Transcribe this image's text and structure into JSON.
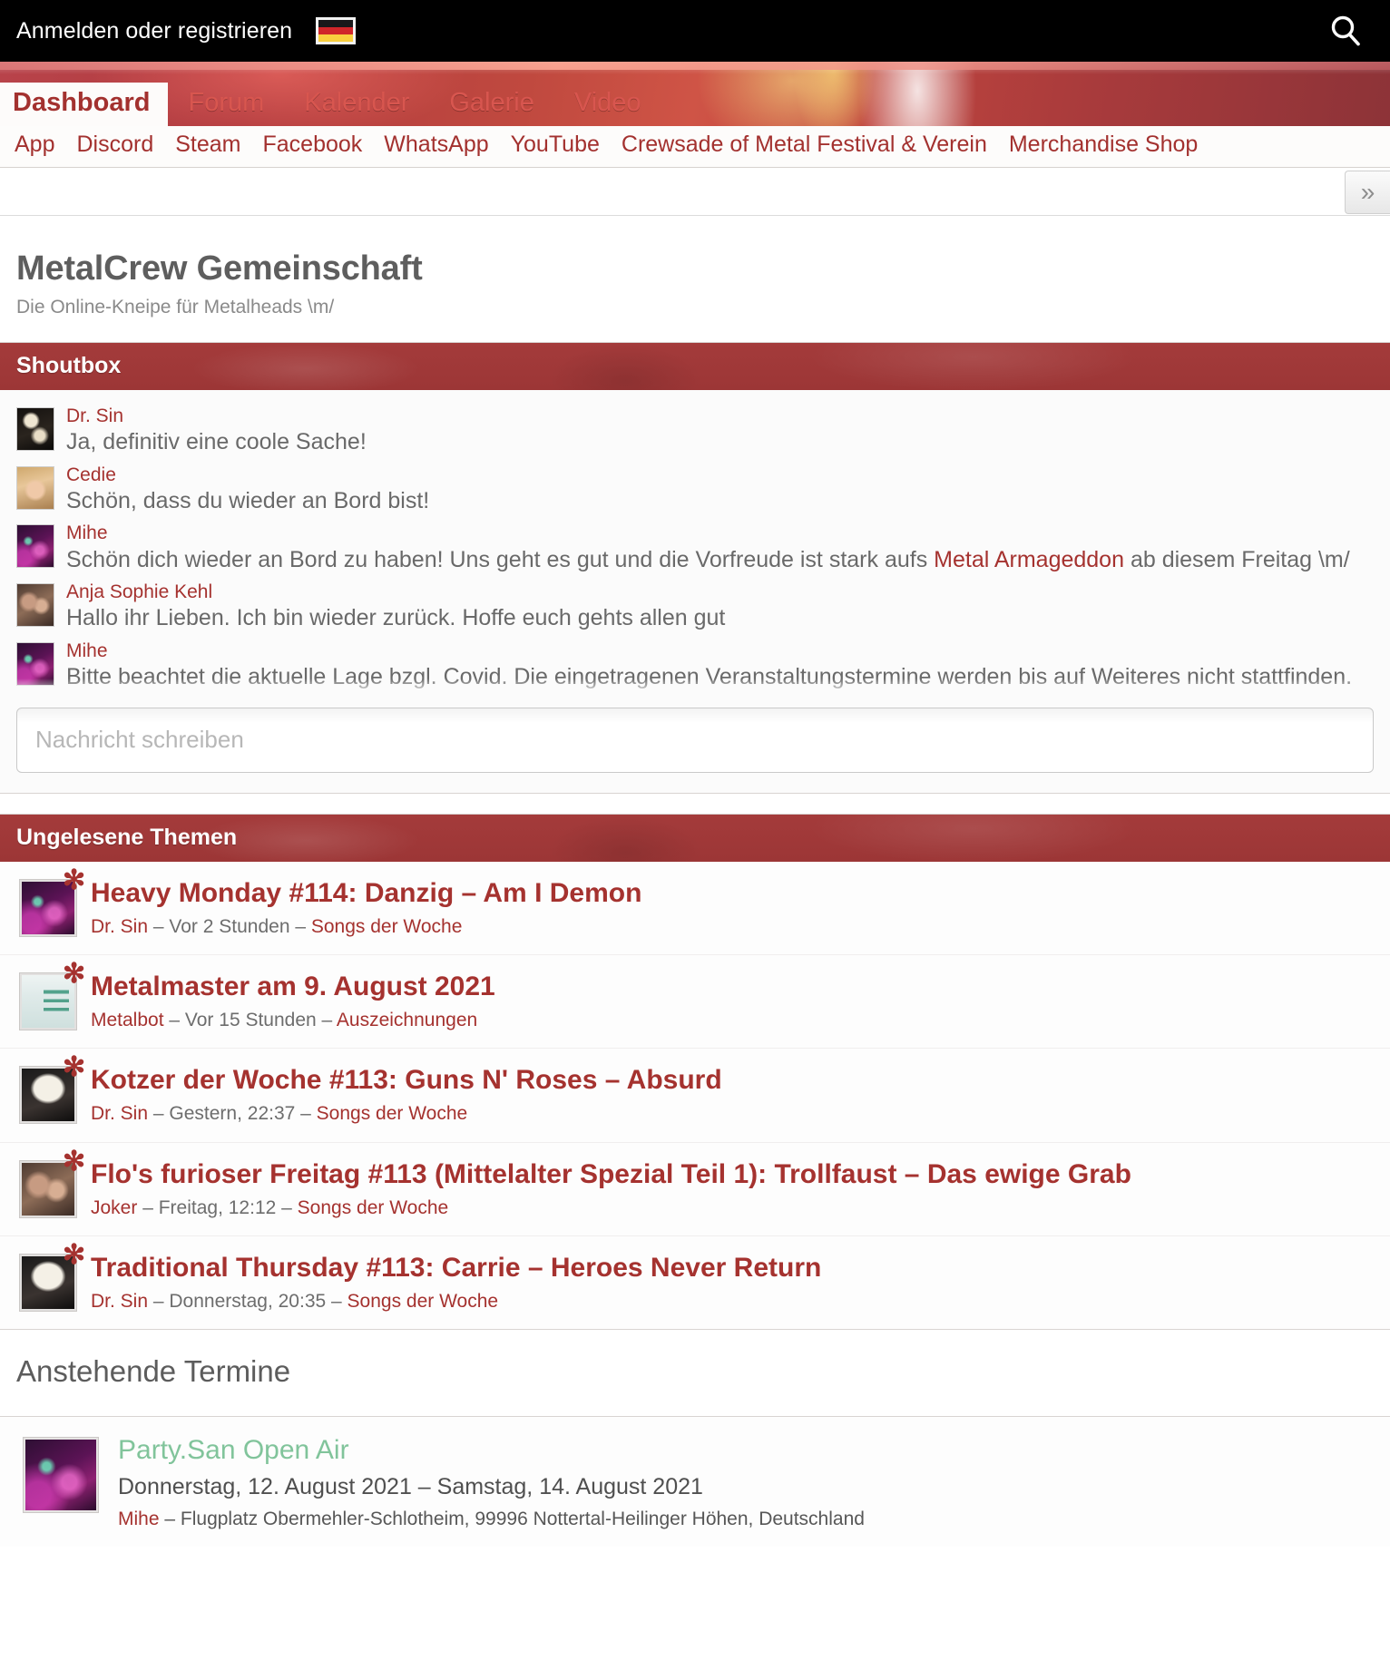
{
  "topbar": {
    "login_label": "Anmelden oder registrieren",
    "language": "Deutsch",
    "search_icon": "search-icon"
  },
  "tabs": [
    {
      "label": "Dashboard",
      "active": true
    },
    {
      "label": "Forum",
      "active": false
    },
    {
      "label": "Kalender",
      "active": false
    },
    {
      "label": "Galerie",
      "active": false
    },
    {
      "label": "Video",
      "active": false
    }
  ],
  "subnav": [
    {
      "label": "App"
    },
    {
      "label": "Discord"
    },
    {
      "label": "Steam"
    },
    {
      "label": "Facebook"
    },
    {
      "label": "WhatsApp"
    },
    {
      "label": "YouTube"
    },
    {
      "label": "Crewsade of Metal Festival & Verein"
    },
    {
      "label": "Merchandise Shop"
    }
  ],
  "expand_button_label": "»",
  "page": {
    "title": "MetalCrew Gemeinschaft",
    "subtitle": "Die Online-Kneipe für Metalheads \\m/"
  },
  "shoutbox": {
    "header": "Shoutbox",
    "input_placeholder": "Nachricht schreiben",
    "input_value": "",
    "messages": [
      {
        "user": "Dr. Sin",
        "avatar": "cat",
        "text": "Ja, definitiv eine coole Sache!",
        "link_text": "",
        "text_after": ""
      },
      {
        "user": "Cedie",
        "avatar": "blonde",
        "text": "Schön, dass du wieder an Bord bist!",
        "link_text": "",
        "text_after": ""
      },
      {
        "user": "Mihe",
        "avatar": "crowd",
        "text": "Schön dich wieder an Bord zu haben! Uns geht es gut und die Vorfreude ist stark aufs ",
        "link_text": "Metal Armageddon",
        "text_after": " ab diesem Freitag \\m/"
      },
      {
        "user": "Anja Sophie Kehl",
        "avatar": "couple",
        "text": "Hallo ihr Lieben. Ich bin wieder zurück. Hoffe euch gehts allen gut",
        "link_text": "",
        "text_after": ""
      },
      {
        "user": "Mihe",
        "avatar": "crowd",
        "text": "Bitte beachtet die aktuelle Lage bzgl. Covid. Die eingetragenen Veranstaltungstermine werden bis auf Weiteres nicht stattfinden.",
        "link_text": "",
        "text_after": ""
      }
    ]
  },
  "threads": {
    "header": "Ungelesene Themen",
    "items": [
      {
        "title": "Heavy Monday #114: Danzig – Am I Demon",
        "author": "Dr. Sin",
        "time": "Vor 2 Stunden",
        "category": "Songs der Woche",
        "avatar": "crowd",
        "unread": true
      },
      {
        "title": "Metalmaster am 9. August 2021",
        "author": "Metalbot",
        "time": "Vor 15 Stunden",
        "category": "Auszeichnungen",
        "avatar": "poster",
        "unread": true
      },
      {
        "title": "Kotzer der Woche #113: Guns N' Roses – Absurd",
        "author": "Dr. Sin",
        "time": "Gestern, 22:37",
        "category": "Songs der Woche",
        "avatar": "mask",
        "unread": true
      },
      {
        "title": "Flo's furioser Freitag #113 (Mittelalter Spezial Teil 1): Trollfaust – Das ewige Grab",
        "author": "Joker",
        "time": "Freitag, 12:12",
        "category": "Songs der Woche",
        "avatar": "couple",
        "unread": true
      },
      {
        "title": "Traditional Thursday #113: Carrie – Heroes Never Return",
        "author": "Dr. Sin",
        "time": "Donnerstag, 20:35",
        "category": "Songs der Woche",
        "avatar": "mask",
        "unread": true
      }
    ],
    "separator": "–",
    "unread_marker": "✻"
  },
  "events": {
    "header": "Anstehende Termine",
    "items": [
      {
        "title": "Party.San Open Air",
        "date": "Donnerstag, 12. August 2021 – Samstag, 14. August 2021",
        "author": "Mihe",
        "location": "Flugplatz Obermehler-Schlotheim, 99996 Nottertal-Heilinger Höhen, Deutschland",
        "separator": "–",
        "avatar": "crowd"
      }
    ]
  },
  "colors": {
    "brand_red": "#a5322f",
    "header_red": "#9c3636",
    "text_grey": "#696969",
    "event_green": "#81c49b",
    "black_bar": "#000000"
  }
}
